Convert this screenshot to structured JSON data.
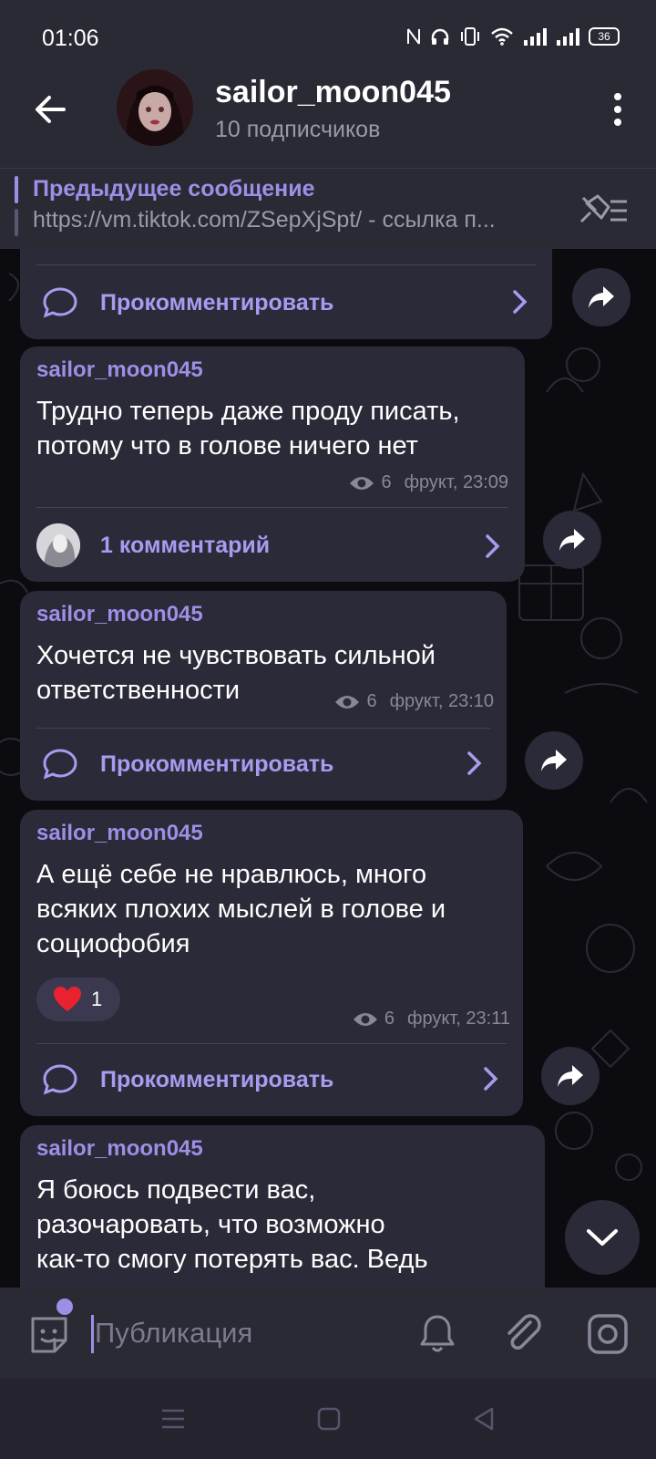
{
  "status_bar": {
    "time": "01:06",
    "battery": "36"
  },
  "header": {
    "title": "sailor_moon045",
    "subtitle": "10 подписчиков"
  },
  "pinned": {
    "title": "Предыдущее сообщение",
    "text": "https://vm.tiktok.com/ZSepXjSpt/ - ссылка п..."
  },
  "messages": [
    {
      "author": "",
      "text": "",
      "comment_label": "Прокомментировать"
    },
    {
      "author": "sailor_moon045",
      "text_lines": [
        "Трудно теперь даже проду писать,",
        "потому что в голове ничего нет"
      ],
      "views": "6",
      "time": "фрукт, 23:09",
      "comment_label": "1 комментарий"
    },
    {
      "author": "sailor_moon045",
      "text_lines": [
        "Хочется не чувствовать сильной",
        "ответственности"
      ],
      "views": "6",
      "time": "фрукт, 23:10",
      "comment_label": "Прокомментировать"
    },
    {
      "author": "sailor_moon045",
      "text_lines": [
        "А ещё себе не нравлюсь, много",
        "всяких плохих мыслей в голове и",
        "социофобия"
      ],
      "reaction": {
        "emoji": "heart",
        "count": "1"
      },
      "views": "6",
      "time": "фрукт, 23:11",
      "comment_label": "Прокомментировать"
    },
    {
      "author": "sailor_moon045",
      "text_lines": [
        "Я боюсь подвести вас,",
        "разочаровать, что возможно",
        "как-то смогу потерять вас. Ведь"
      ]
    }
  ],
  "composer": {
    "placeholder": "Публикация"
  },
  "icons": {
    "back": "arrow-left-icon",
    "menu": "more-vertical-icon",
    "unpin": "pin-list-icon",
    "comment": "comment-bubble-icon",
    "share": "share-arrow-icon",
    "views": "eye-icon",
    "emoji": "sticker-icon",
    "bell": "bell-icon",
    "attach": "paperclip-icon",
    "camera": "instagram-camera-icon"
  },
  "colors": {
    "accent": "#9d8fe6",
    "bubble": "#2b2a38",
    "bar": "#2a2a35",
    "background": "#0c0c10",
    "heart": "#e8232f"
  }
}
